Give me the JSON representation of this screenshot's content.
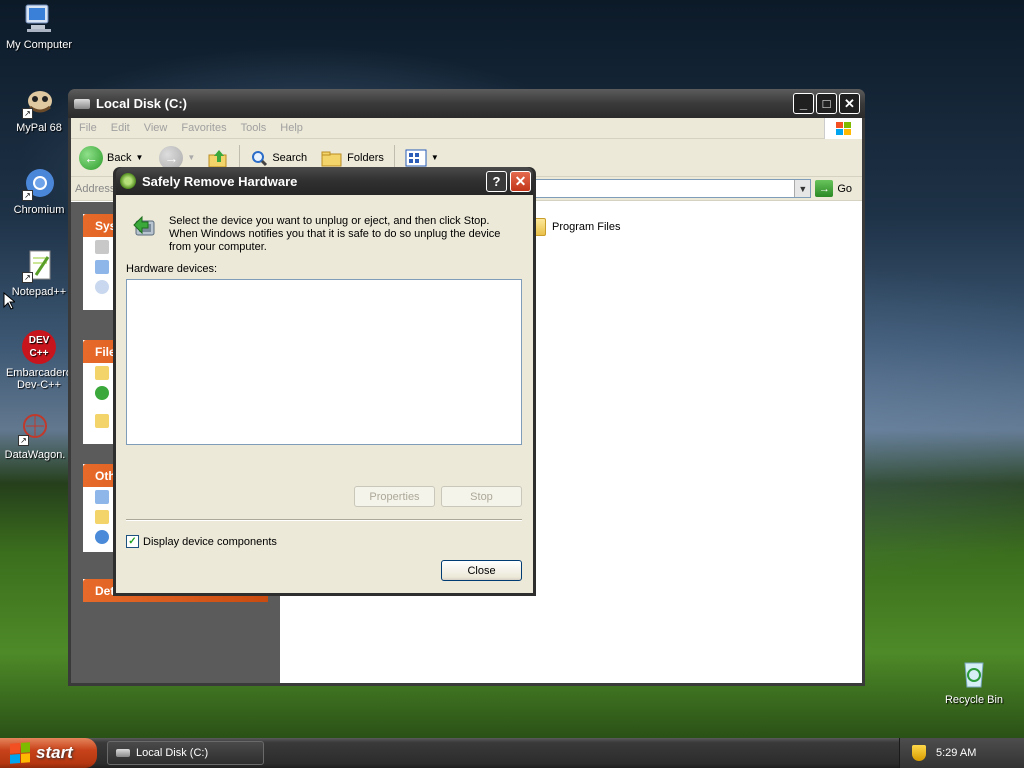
{
  "desktop": {
    "icons": [
      {
        "label": "My Computer",
        "icon": "computer-icon"
      },
      {
        "label": "MyPal 68",
        "icon": "mypal-icon"
      },
      {
        "label": "Chromium",
        "icon": "chromium-icon"
      },
      {
        "label": "Notepad++",
        "icon": "notepadpp-icon"
      },
      {
        "label": "Embarcadero Dev-C++",
        "label_line1": "Embarcadero",
        "label_line2": "Dev-C++",
        "icon_text": "DEV C++",
        "icon": "devcpp-icon"
      },
      {
        "label": "DataWagon.",
        "icon": "datawagon-icon"
      },
      {
        "label": "Recycle Bin",
        "icon": "recycle-bin-icon"
      }
    ]
  },
  "explorer": {
    "title": "Local Disk (C:)",
    "menu": [
      "File",
      "Edit",
      "View",
      "Favorites",
      "Tools",
      "Help"
    ],
    "toolbar": {
      "back": "Back",
      "search": "Search",
      "folders": "Folders"
    },
    "address_label": "Address",
    "go_label": "Go",
    "task_headers": [
      "Sys",
      "File",
      "Oth",
      "Det"
    ],
    "items": [
      {
        "name": "Program Files",
        "icon": "folder-icon"
      }
    ]
  },
  "dialog": {
    "title": "Safely Remove Hardware",
    "help": "?",
    "instructions": "Select the device you want to unplug or eject, and then click Stop. When Windows notifies you that it is safe to do so unplug the device from your computer.",
    "hardware_label": "Hardware devices:",
    "hardware_devices": [],
    "properties_label": "Properties",
    "stop_label": "Stop",
    "display_components_label": "Display device components",
    "display_components_checked": true,
    "close_label": "Close"
  },
  "taskbar": {
    "start_label": "start",
    "task_label": "Local Disk (C:)",
    "clock": "5:29 AM"
  },
  "colors": {
    "start_button": "#c8431a",
    "explorer_task_header": "#e86a2a",
    "dialog_face": "#ece9d8",
    "titlebar": "#303030"
  }
}
